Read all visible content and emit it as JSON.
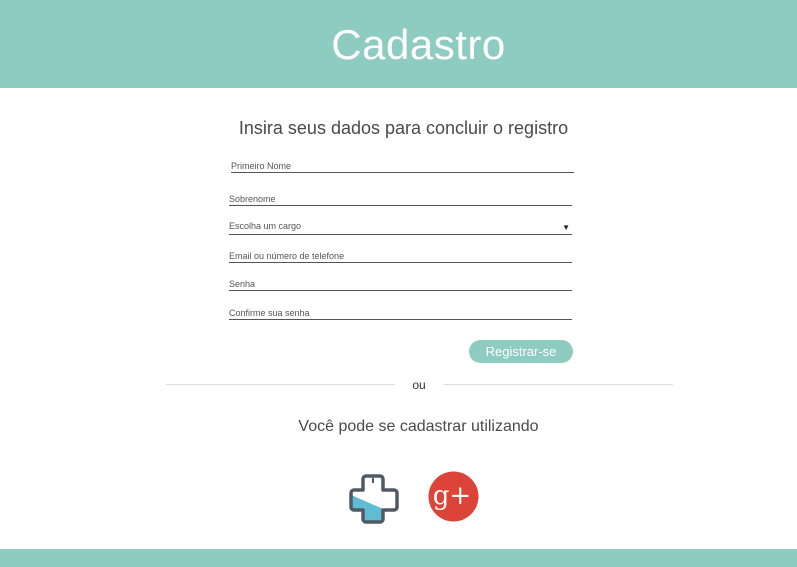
{
  "header": {
    "title": "Cadastro"
  },
  "form": {
    "subtitle": "Insira seus dados para concluir o registro",
    "first_name_placeholder": "Primeiro Nome",
    "last_name_placeholder": "Sobrenome",
    "role_select_value": "Escolha um cargo",
    "email_phone_placeholder": "Email ou número de telefone",
    "password_placeholder": "Senha",
    "confirm_password_placeholder": "Confirme sua senha",
    "submit_label": "Registrar-se"
  },
  "divider": {
    "label": "ou"
  },
  "social": {
    "prompt": "Você pode se cadastrar utilizando",
    "providers": [
      {
        "name": "health-cross-icon",
        "colors": {
          "fill": "#5fbcd3",
          "stroke": "#505a63"
        }
      },
      {
        "name": "google-plus-icon",
        "label": "g+",
        "colors": {
          "fill": "#db4437"
        }
      }
    ]
  },
  "colors": {
    "accent": "#8ecbc1",
    "text": "#4a4a4a",
    "line": "#555555"
  }
}
